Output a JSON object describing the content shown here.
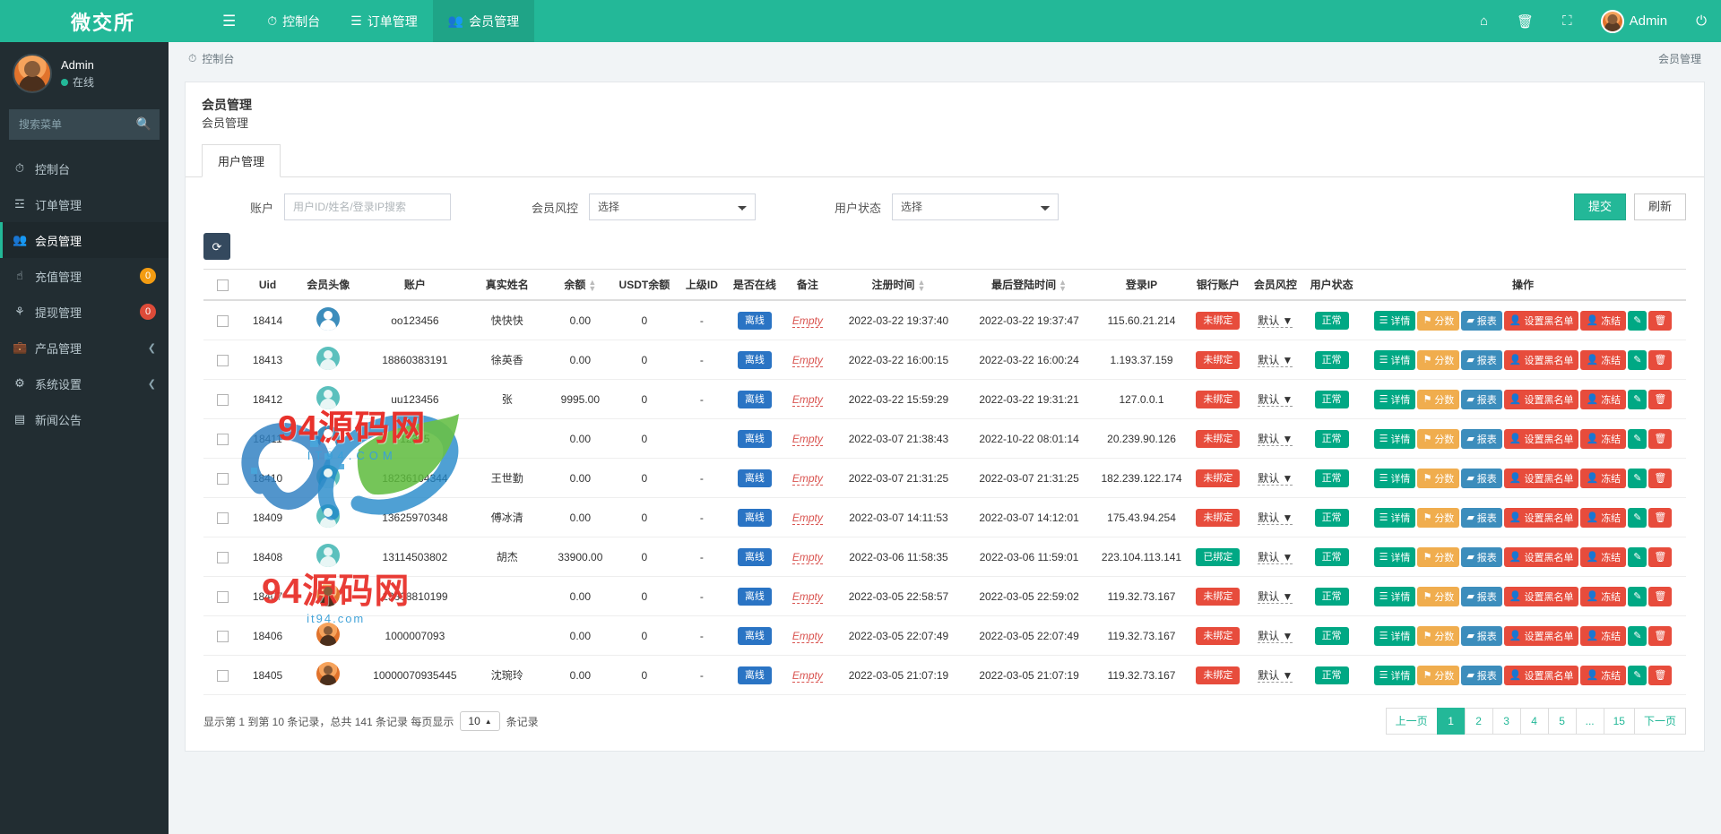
{
  "brand": "微交所",
  "topnav": {
    "hamburger_icon": "hamburger-icon",
    "items": [
      {
        "label": "控制台",
        "icon": "dashboard-icon",
        "active": false
      },
      {
        "label": "订单管理",
        "icon": "list-icon",
        "active": false
      },
      {
        "label": "会员管理",
        "icon": "users-icon",
        "active": true
      }
    ],
    "right": {
      "home_icon": "home-icon",
      "trash_icon": "trash-icon",
      "fullscreen_icon": "fullscreen-icon",
      "user_label": "Admin",
      "avatar_icon": "avatar",
      "logout_icon": "logout-icon"
    }
  },
  "sidebar": {
    "user": {
      "name": "Admin",
      "status": "在线"
    },
    "search": {
      "placeholder": "搜索菜单",
      "icon": "search-icon"
    },
    "items": [
      {
        "label": "控制台",
        "icon": "dashboard-icon",
        "active": false,
        "badge": "",
        "badge_color": "",
        "caret": false
      },
      {
        "label": "订单管理",
        "icon": "list-icon",
        "active": false,
        "badge": "",
        "badge_color": "",
        "caret": false
      },
      {
        "label": "会员管理",
        "icon": "users-icon",
        "active": true,
        "badge": "",
        "badge_color": "",
        "caret": false
      },
      {
        "label": "充值管理",
        "icon": "hand-icon",
        "active": false,
        "badge": "0",
        "badge_color": "orange",
        "caret": false
      },
      {
        "label": "提现管理",
        "icon": "share-icon",
        "active": false,
        "badge": "0",
        "badge_color": "red",
        "caret": false
      },
      {
        "label": "产品管理",
        "icon": "briefcase-icon",
        "active": false,
        "badge": "",
        "badge_color": "",
        "caret": true
      },
      {
        "label": "系统设置",
        "icon": "gears-icon",
        "active": false,
        "badge": "",
        "badge_color": "",
        "caret": true
      },
      {
        "label": "新闻公告",
        "icon": "news-icon",
        "active": false,
        "badge": "",
        "badge_color": "",
        "caret": false
      }
    ]
  },
  "breadcrumb": {
    "icon": "dashboard-icon",
    "label": "控制台",
    "right_label": "会员管理"
  },
  "panel": {
    "title": "会员管理",
    "subtitle": "会员管理",
    "tabs": [
      {
        "label": "用户管理",
        "active": true
      }
    ]
  },
  "filters": {
    "account_label": "账户",
    "account_placeholder": "用户ID/姓名/登录IP搜索",
    "account_value": "",
    "risk_label": "会员风控",
    "risk_value": "选择",
    "risk_options": [
      "选择"
    ],
    "status_label": "用户状态",
    "status_value": "选择",
    "status_options": [
      "选择"
    ],
    "submit_label": "提交",
    "refresh_label": "刷新"
  },
  "toolbar": {
    "refresh_icon": "refresh-icon"
  },
  "table": {
    "columns": [
      {
        "key": "check",
        "label": "",
        "sortable": false
      },
      {
        "key": "uid",
        "label": "Uid",
        "sortable": false
      },
      {
        "key": "avatar",
        "label": "会员头像",
        "sortable": false
      },
      {
        "key": "account",
        "label": "账户",
        "sortable": false
      },
      {
        "key": "realname",
        "label": "真实姓名",
        "sortable": false
      },
      {
        "key": "balance",
        "label": "余额",
        "sortable": true
      },
      {
        "key": "usdt",
        "label": "USDT余额",
        "sortable": false
      },
      {
        "key": "parent",
        "label": "上级ID",
        "sortable": false
      },
      {
        "key": "online",
        "label": "是否在线",
        "sortable": false
      },
      {
        "key": "remark",
        "label": "备注",
        "sortable": false
      },
      {
        "key": "regtime",
        "label": "注册时间",
        "sortable": true
      },
      {
        "key": "lasttime",
        "label": "最后登陆时间",
        "sortable": true
      },
      {
        "key": "ip",
        "label": "登录IP",
        "sortable": false
      },
      {
        "key": "bank",
        "label": "银行账户",
        "sortable": false
      },
      {
        "key": "risk",
        "label": "会员风控",
        "sortable": false
      },
      {
        "key": "ustatus",
        "label": "用户状态",
        "sortable": false
      },
      {
        "key": "ops",
        "label": "操作",
        "sortable": false
      }
    ],
    "ops_labels": {
      "detail": "详情",
      "score": "分数",
      "report": "报表",
      "blacklist": "设置黑名单",
      "freeze": "冻结",
      "edit_icon": "pencil-icon",
      "delete_icon": "trash-icon",
      "detail_icon": "list-icon",
      "score_icon": "flag-icon",
      "report_icon": "chart-icon",
      "blacklist_icon": "user-icon",
      "freeze_icon": "user-icon"
    },
    "rows": [
      {
        "uid": "18414",
        "avatar": "blue",
        "account": "oo123456",
        "realname": "快快快",
        "balance": "0.00",
        "usdt": "0",
        "parent": "-",
        "online": "离线",
        "remark": "Empty",
        "regtime": "2022-03-22 19:37:40",
        "lasttime": "2022-03-22 19:37:47",
        "ip": "115.60.21.214",
        "bank": "未绑定",
        "bank_bound": false,
        "risk": "默认",
        "ustatus": "正常"
      },
      {
        "uid": "18413",
        "avatar": "teal",
        "account": "18860383191",
        "realname": "徐英香",
        "balance": "0.00",
        "usdt": "0",
        "parent": "-",
        "online": "离线",
        "remark": "Empty",
        "regtime": "2022-03-22 16:00:15",
        "lasttime": "2022-03-22 16:00:24",
        "ip": "1.193.37.159",
        "bank": "未绑定",
        "bank_bound": false,
        "risk": "默认",
        "ustatus": "正常"
      },
      {
        "uid": "18412",
        "avatar": "teal",
        "account": "uu123456",
        "realname": "张",
        "balance": "9995.00",
        "usdt": "0",
        "parent": "-",
        "online": "离线",
        "remark": "Empty",
        "regtime": "2022-03-22 15:59:29",
        "lasttime": "2022-03-22 19:31:21",
        "ip": "127.0.0.1",
        "bank": "未绑定",
        "bank_bound": false,
        "risk": "默认",
        "ustatus": "正常"
      },
      {
        "uid": "18411",
        "avatar": "blue",
        "account": "12345",
        "realname": "",
        "balance": "0.00",
        "usdt": "0",
        "parent": "",
        "online": "离线",
        "remark": "Empty",
        "regtime": "2022-03-07 21:38:43",
        "lasttime": "2022-10-22 08:01:14",
        "ip": "20.239.90.126",
        "bank": "未绑定",
        "bank_bound": false,
        "risk": "默认",
        "ustatus": "正常"
      },
      {
        "uid": "18410",
        "avatar": "teal",
        "account": "18236104344",
        "realname": "王世勤",
        "balance": "0.00",
        "usdt": "0",
        "parent": "-",
        "online": "离线",
        "remark": "Empty",
        "regtime": "2022-03-07 21:31:25",
        "lasttime": "2022-03-07 21:31:25",
        "ip": "182.239.122.174",
        "bank": "未绑定",
        "bank_bound": false,
        "risk": "默认",
        "ustatus": "正常"
      },
      {
        "uid": "18409",
        "avatar": "teal",
        "account": "13625970348",
        "realname": "傅冰清",
        "balance": "0.00",
        "usdt": "0",
        "parent": "-",
        "online": "离线",
        "remark": "Empty",
        "regtime": "2022-03-07 14:11:53",
        "lasttime": "2022-03-07 14:12:01",
        "ip": "175.43.94.254",
        "bank": "未绑定",
        "bank_bound": false,
        "risk": "默认",
        "ustatus": "正常"
      },
      {
        "uid": "18408",
        "avatar": "teal",
        "account": "13114503802",
        "realname": "胡杰",
        "balance": "33900.00",
        "usdt": "0",
        "parent": "-",
        "online": "离线",
        "remark": "Empty",
        "regtime": "2022-03-06 11:58:35",
        "lasttime": "2022-03-06 11:59:01",
        "ip": "223.104.113.141",
        "bank": "已绑定",
        "bank_bound": true,
        "risk": "默认",
        "ustatus": "正常"
      },
      {
        "uid": "18407",
        "avatar": "orange",
        "account": "13808810199",
        "realname": "",
        "balance": "0.00",
        "usdt": "0",
        "parent": "-",
        "online": "离线",
        "remark": "Empty",
        "regtime": "2022-03-05 22:58:57",
        "lasttime": "2022-03-05 22:59:02",
        "ip": "119.32.73.167",
        "bank": "未绑定",
        "bank_bound": false,
        "risk": "默认",
        "ustatus": "正常"
      },
      {
        "uid": "18406",
        "avatar": "orange",
        "account": "1000007093",
        "realname": "",
        "balance": "0.00",
        "usdt": "0",
        "parent": "-",
        "online": "离线",
        "remark": "Empty",
        "regtime": "2022-03-05 22:07:49",
        "lasttime": "2022-03-05 22:07:49",
        "ip": "119.32.73.167",
        "bank": "未绑定",
        "bank_bound": false,
        "risk": "默认",
        "ustatus": "正常"
      },
      {
        "uid": "18405",
        "avatar": "orange",
        "account": "10000070935445",
        "realname": "沈琬玲",
        "balance": "0.00",
        "usdt": "0",
        "parent": "-",
        "online": "离线",
        "remark": "Empty",
        "regtime": "2022-03-05 21:07:19",
        "lasttime": "2022-03-05 21:07:19",
        "ip": "119.32.73.167",
        "bank": "未绑定",
        "bank_bound": false,
        "risk": "默认",
        "ustatus": "正常"
      }
    ]
  },
  "footer": {
    "info_prefix": "显示第 1 到第 10 条记录，总共 141 条记录 每页显示",
    "page_size": "10",
    "info_suffix": "条记录",
    "pagination": {
      "prev": "上一页",
      "pages": [
        "1",
        "2",
        "3",
        "4",
        "5",
        "...",
        "15"
      ],
      "active": "1",
      "next": "下一页"
    }
  },
  "watermark": {
    "main": "94源码网",
    "sub": "it94.com",
    "main2": "94源码网",
    "sub2": "IT94.COM"
  },
  "colors": {
    "brand": "#23b898",
    "sidebar": "#222d32",
    "danger": "#e74c3c",
    "warning": "#f0ad4e",
    "info": "#3c8dbc"
  }
}
